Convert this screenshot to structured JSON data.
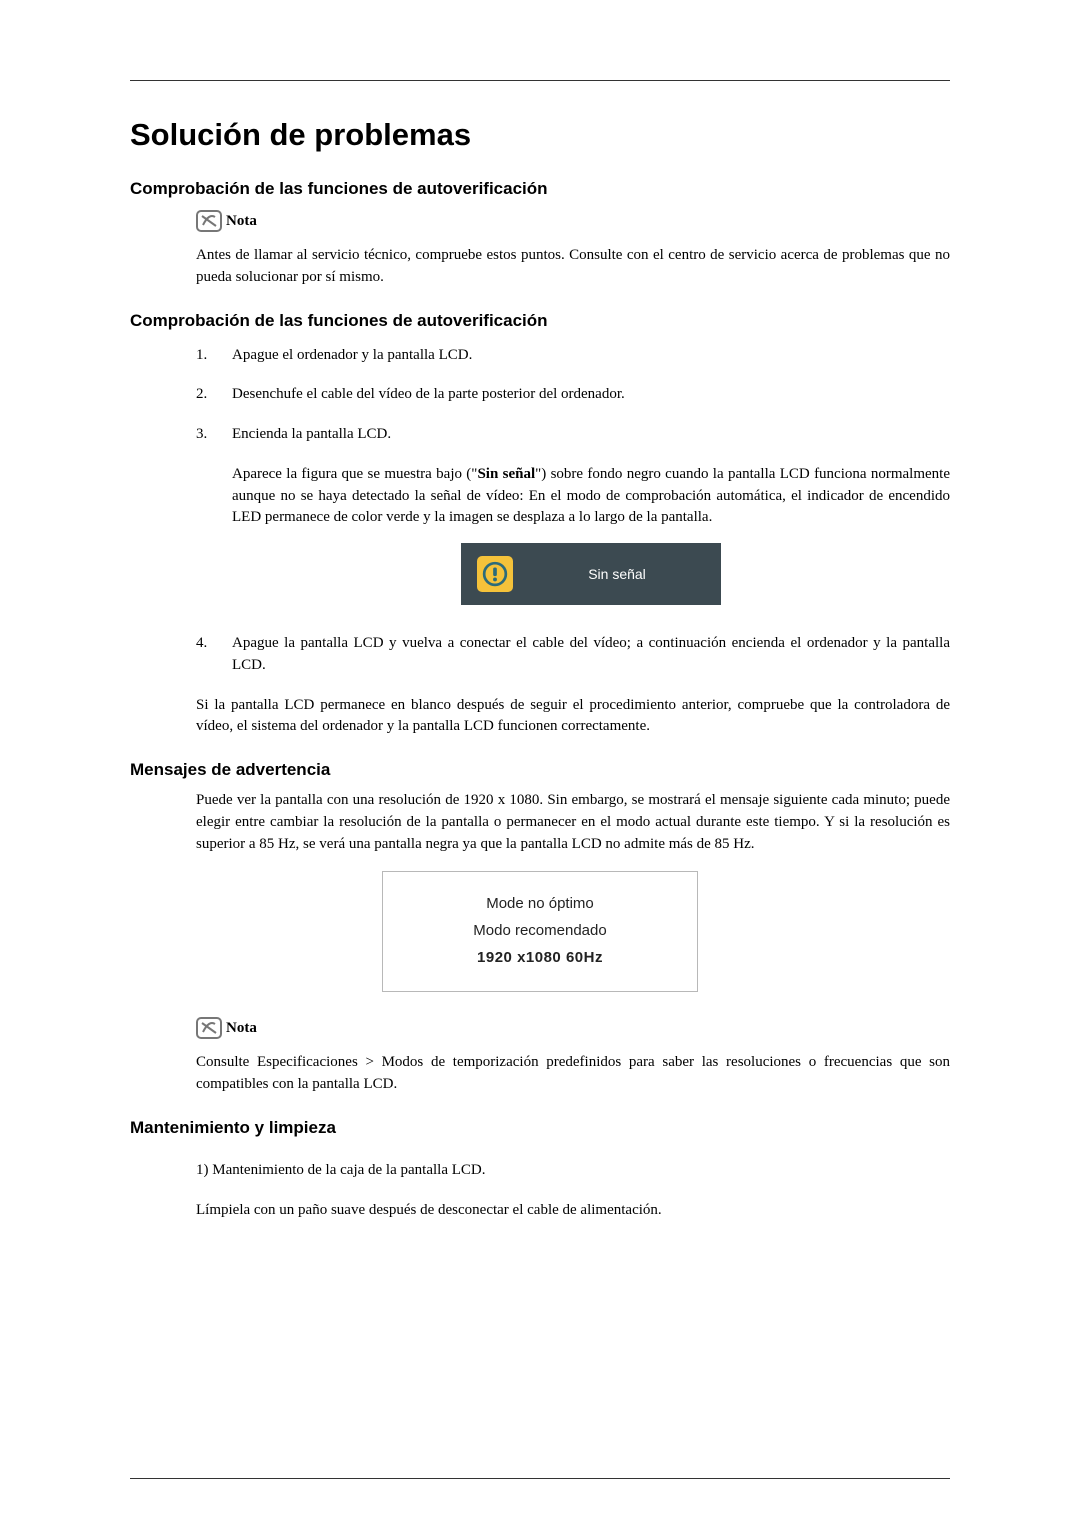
{
  "title": "Solución de problemas",
  "section1": {
    "heading": "Comprobación de las funciones de autoverificación",
    "noteLabel": "Nota",
    "noteBody": "Antes de llamar al servicio técnico, compruebe estos puntos. Consulte con el centro de servicio acerca de problemas que no pueda solucionar por sí mismo."
  },
  "section2": {
    "heading": "Comprobación de las funciones de autoverificación",
    "step1": "Apague el ordenador y la pantalla LCD.",
    "step2": "Desenchufe el cable del vídeo de la parte posterior del ordenador.",
    "step3": "Encienda la pantalla LCD.",
    "step3DetailPrefix": "Aparece la figura que se muestra bajo (\"",
    "step3DetailBold": "Sin señal",
    "step3DetailSuffix": "\") sobre fondo negro cuando la pantalla LCD funciona normalmente aunque no se haya detectado la señal de vídeo: En el modo de comprobación automática, el indicador de encendido LED permanece de color verde y la imagen se desplaza a lo largo de la pantalla.",
    "figSinSenal": "Sin señal",
    "step4": "Apague la pantalla LCD y vuelva a conectar el cable del vídeo; a continuación encienda el ordenador y la pantalla LCD.",
    "closing": "Si la pantalla LCD permanece en blanco después de seguir el procedimiento anterior, compruebe que la controladora de vídeo, el sistema del ordenador y la pantalla LCD funcionen correctamente."
  },
  "section3": {
    "heading": "Mensajes de advertencia",
    "body": "Puede ver la pantalla con una resolución de 1920 x 1080. Sin embargo, se mostrará el mensaje siguiente cada minuto; puede elegir entre cambiar la resolución de la pantalla o permanecer en el modo actual durante este tiempo. Y si la resolución es superior a 85 Hz, se verá una pantalla negra ya que la pantalla LCD no admite más de 85 Hz.",
    "figLine1": "Mode no óptimo",
    "figLine2": "Modo recomendado",
    "figLine3": "1920 x1080  60Hz",
    "noteLabel": "Nota",
    "noteBody": "Consulte Especificaciones > Modos de temporización predefinidos para saber las resoluciones o frecuencias que son compatibles con la pantalla LCD."
  },
  "section4": {
    "heading": "Mantenimiento y limpieza",
    "line1": "1) Mantenimiento de la caja de la pantalla LCD.",
    "line2": "Límpiela con un paño suave después de desconectar el cable de alimentación."
  }
}
